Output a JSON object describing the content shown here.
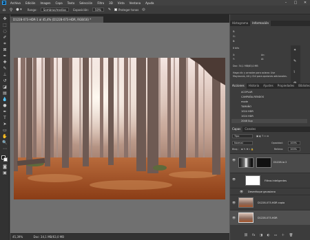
{
  "menu": {
    "app_icon": "Ps",
    "items": [
      "Archivo",
      "Edición",
      "Imagen",
      "Capa",
      "Texto",
      "Selección",
      "Filtro",
      "3D",
      "Vista",
      "Ventana",
      "Ayuda"
    ],
    "window_controls": [
      "–",
      "□",
      "✕"
    ]
  },
  "options": {
    "mode_label": "Rango:",
    "mode_value": "Sombras/medios",
    "exposure_label": "Exposición:",
    "exposure_value": "50%",
    "protect_label": "Proteger tonos"
  },
  "document": {
    "tab_title": "D1228-073-HDR-1 al 45,4% (D1228-073-HDR, RGB/16) *",
    "status_zoom": "45,39%",
    "status_doc": "Doc: 34,1 MB/63,0 MB"
  },
  "top_panel": {
    "tabs": [
      "Histograma",
      "Información"
    ],
    "active_tab": "Información",
    "rows": [
      "R:",
      "G:",
      "B:",
      "8 bits",
      "X:",
      "Y:",
      "An:",
      "Al:"
    ],
    "doc_info": "Doc: 34,1 MB/63,0 MB",
    "hint": "Haga clic y arrastre para aclarar. Use Mayúscula, Alt y Ctrl para opciones adicionales."
  },
  "history_panel": {
    "tabs": [
      "Acciones",
      "Historia",
      "Ajustes",
      "Propiedades",
      "Bibliotecas"
    ],
    "active_tab": "Acciones",
    "items": [
      "ACOPLAR",
      "CAMPAÑA-RENDOS",
      "mode",
      "TAMAÑO",
      "1024 HDR",
      "1024 HDR",
      "1024 HDR",
      "2048 Sup"
    ]
  },
  "layers_panel": {
    "tabs": [
      "Capas",
      "Canales"
    ],
    "active_tab": "Capas",
    "kind_label": "Tipo",
    "blend_mode": "Normal",
    "opacity_label": "Opacidad:",
    "opacity_value": "100%",
    "lock_label": "Bloq.:",
    "fill_label": "Relleno:",
    "fill_value": "100%",
    "layers": [
      {
        "name": "D1228-lo 2"
      },
      {
        "name": "Filtros inteligentes"
      },
      {
        "name": "Desenfoque gaussiano"
      },
      {
        "name": "D1228-073-HDR copia"
      },
      {
        "name": "D1228-073-HDR"
      }
    ]
  },
  "colors": {
    "accent": "#31a8ff",
    "panel": "#3c3c3c",
    "menubar": "#424242",
    "canvas": "#707070"
  }
}
